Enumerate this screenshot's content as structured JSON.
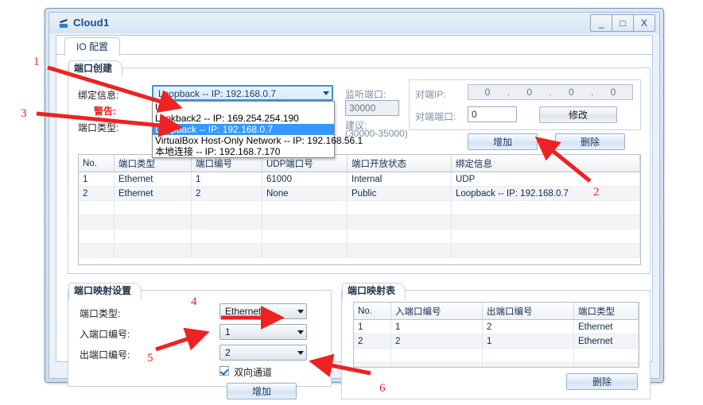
{
  "window": {
    "title": "Cloud1",
    "icon": "cloud-app-icon",
    "buttons": {
      "minimize": "_",
      "maximize": "□",
      "close": "X"
    }
  },
  "tab": {
    "label": "IO 配置"
  },
  "port_create": {
    "title": "端口创建",
    "bind_info_label": "绑定信息:",
    "bind_info_value": "Loopback -- IP: 192.168.0.7",
    "port_type_label": "端口类型:",
    "dropdown_options": [
      "UDP",
      "Lookback2 -- IP: 169.254.254.190",
      "Loopback -- IP: 192.168.0.7",
      "VirtualBox Host-Only Network -- IP: 192.168.56.1",
      "本地连接 -- IP: 192.168.7.170"
    ],
    "dropdown_selected_index": 2,
    "listen_port_label": "监听端口:",
    "listen_port_value": "30000",
    "suggest_label": "建议:",
    "suggest_range": "(30000-35000)",
    "peer_ip_label": "对端IP:",
    "peer_ip_octets": [
      "0",
      "0",
      "0",
      "0"
    ],
    "peer_port_label": "对端端口:",
    "peer_port_value": "0",
    "modify_button": "修改",
    "add_button": "增加",
    "delete_button": "删除"
  },
  "port_table": {
    "headers": [
      "No.",
      "端口类型",
      "端口编号",
      "UDP端口号",
      "端口开放状态",
      "绑定信息"
    ],
    "rows": [
      [
        "1",
        "Ethernet",
        "1",
        "61000",
        "Internal",
        "UDP"
      ],
      [
        "2",
        "Ethernet",
        "2",
        "None",
        "Public",
        "Loopback -- IP: 192.168.0.7"
      ]
    ],
    "empty_rows": 4
  },
  "mapping_settings": {
    "title": "端口映射设置",
    "port_type_label": "端口类型:",
    "port_type_value": "Ethernet",
    "in_port_label": "入端口编号:",
    "in_port_value": "1",
    "out_port_label": "出端口编号:",
    "out_port_value": "2",
    "bidirectional_label": "双向通道",
    "bidirectional_checked": true,
    "add_button": "增加"
  },
  "mapping_table": {
    "title": "端口映射表",
    "headers": [
      "No.",
      "入端口编号",
      "出端口编号",
      "端口类型"
    ],
    "rows": [
      [
        "1",
        "1",
        "2",
        "Ethernet"
      ],
      [
        "2",
        "2",
        "1",
        "Ethernet"
      ]
    ],
    "empty_rows": 3,
    "delete_button": "删除"
  },
  "annotations": {
    "color": "#ee2222",
    "warning_text": "警告:",
    "numbers": [
      "1",
      "2",
      "3",
      "4",
      "5",
      "6"
    ]
  }
}
